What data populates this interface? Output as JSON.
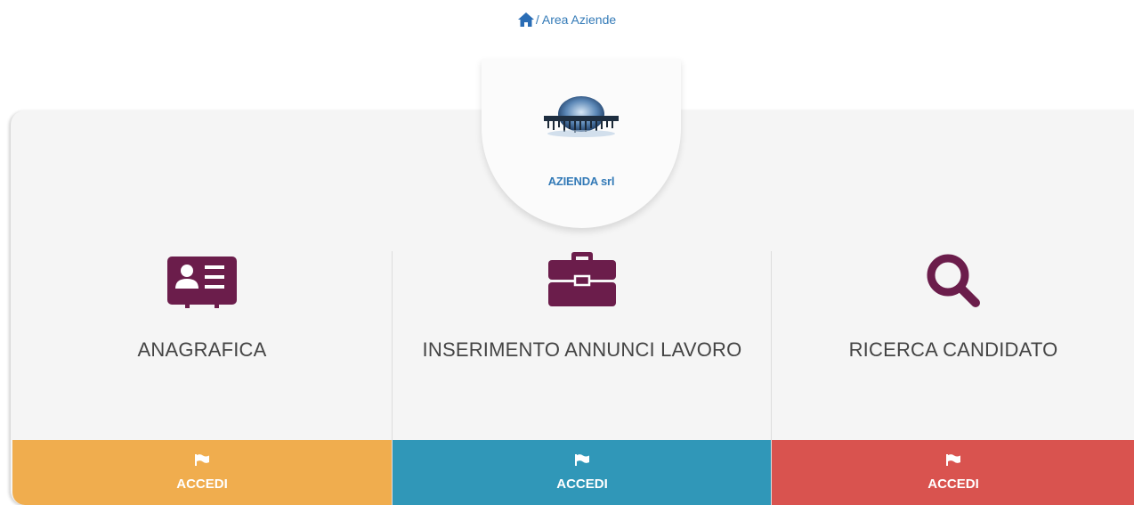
{
  "breadcrumb": {
    "separator": "/",
    "current": "Area Aziende"
  },
  "company": {
    "name": "AZIENDA srl"
  },
  "cards": [
    {
      "title": "ANAGRAFICA",
      "icon": "id-card-icon",
      "button_label": "ACCEDI",
      "color": "#f0ad4e"
    },
    {
      "title": "INSERIMENTO ANNUNCI LAVORO",
      "icon": "briefcase-icon",
      "button_label": "ACCEDI",
      "color": "#3097b8"
    },
    {
      "title": "RICERCA CANDIDATO",
      "icon": "search-icon",
      "button_label": "ACCEDI",
      "color": "#d9534f"
    }
  ],
  "colors": {
    "icon": "#6b1d4b",
    "link": "#337ab7"
  }
}
